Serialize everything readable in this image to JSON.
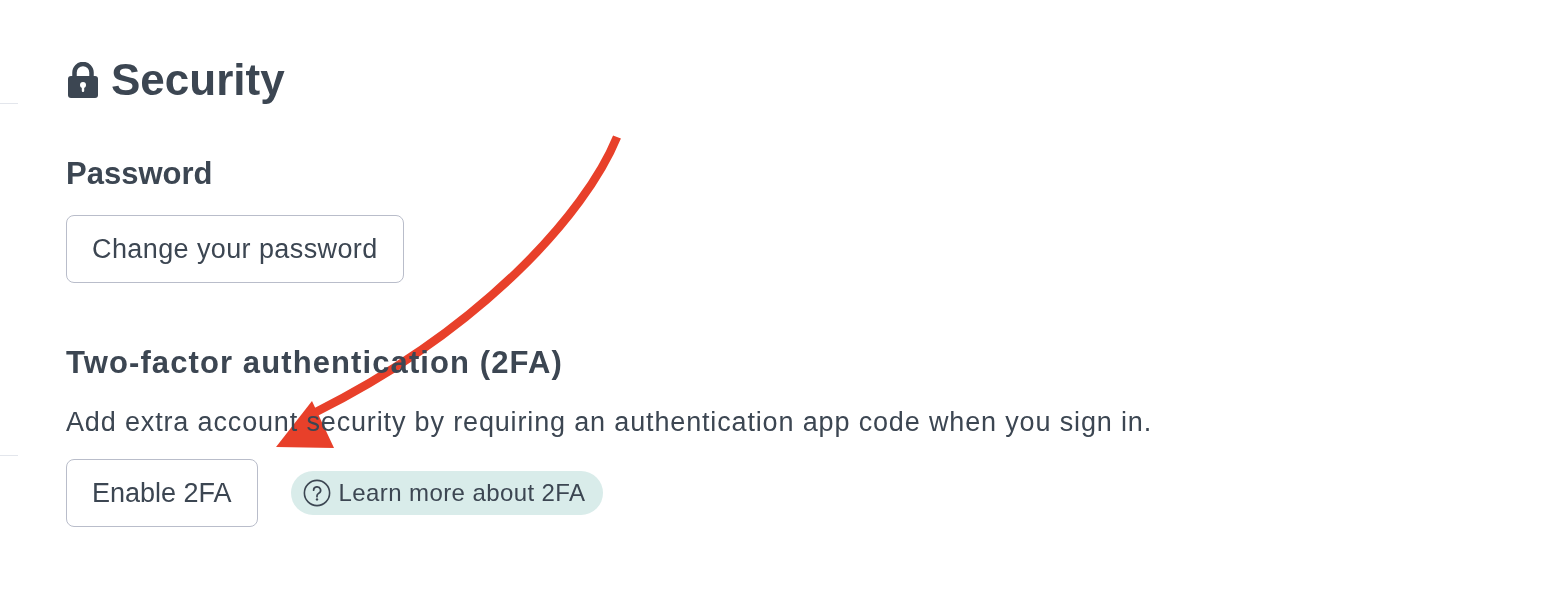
{
  "page": {
    "title": "Security"
  },
  "password": {
    "heading": "Password",
    "button": "Change your password"
  },
  "two_factor": {
    "heading": "Two-factor authentication (2FA)",
    "description": "Add extra account security by requiring an authentication app code when you sign in.",
    "button": "Enable 2FA",
    "help_link": "Learn more about 2FA"
  }
}
